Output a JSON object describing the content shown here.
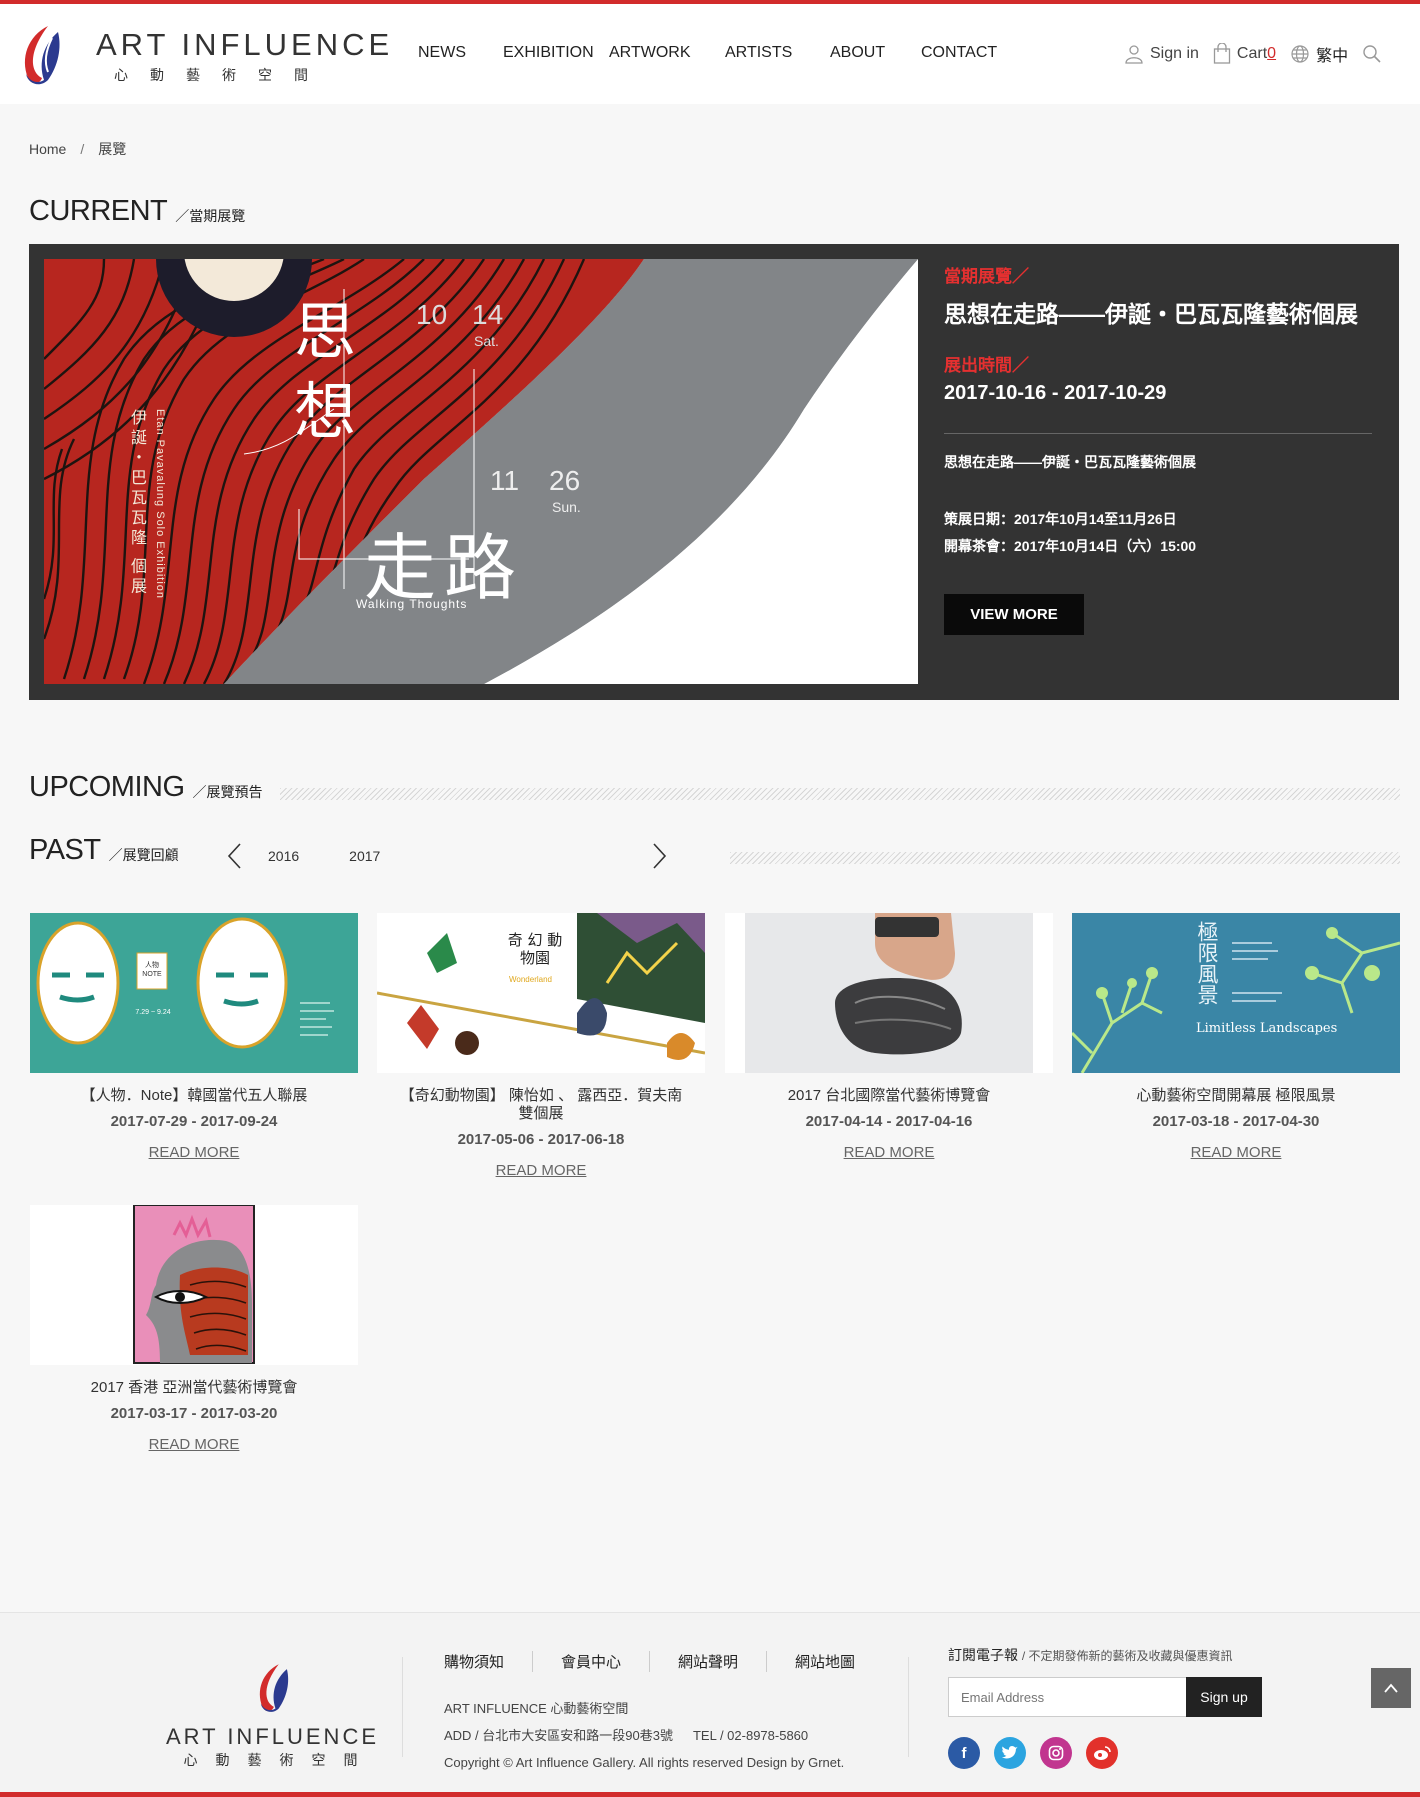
{
  "brand": {
    "en": "ART INFLUENCE",
    "zh": "心動藝術空間"
  },
  "nav": [
    "NEWS",
    "EXHIBITION",
    "ARTWORK",
    "ARTISTS",
    "ABOUT",
    "CONTACT"
  ],
  "header": {
    "signin": "Sign in",
    "cart": "Cart",
    "cart_count": "0",
    "lang": "繁中"
  },
  "breadcrumb": {
    "home": "Home",
    "sep": "/",
    "current": "展覽"
  },
  "sections": {
    "current_en": "CURRENT",
    "current_zh": "／當期展覽",
    "upcoming_en": "UPCOMING",
    "upcoming_zh": "／展覽預告",
    "past_en": "PAST",
    "past_zh": "／展覽回顧"
  },
  "current": {
    "label_current": "當期展覽／",
    "title": "思想在走路——伊誕‧巴瓦瓦隆藝術個展",
    "label_dates": "展出時間／",
    "dates": "2017-10-16 - 2017-10-29",
    "desc": "思想在走路——伊誕‧巴瓦瓦隆藝術個展",
    "curate": "策展日期：2017年10月14至11月26日",
    "opening": "開幕茶會：2017年10月14日（六）15:00",
    "button": "VIEW MORE",
    "poster": {
      "big1": "思",
      "big2": "想",
      "big3": "走",
      "big4": "路",
      "d1a": "10",
      "d1b": "14",
      "d1c": "Sat.",
      "d2a": "11",
      "d2b": "26",
      "d2c": "Sun.",
      "vert_zh": "伊誕・巴瓦瓦隆 個展",
      "vert_en": "Etan Pavavalung Solo Exhibition",
      "sub_en": "Walking Thoughts"
    }
  },
  "years": [
    "2016",
    "2017"
  ],
  "past": [
    {
      "title": "【人物．Note】韓國當代五人聯展",
      "dates": "2017-07-29 - 2017-09-24",
      "more": "READ MORE",
      "note_badge": "人物 NOTE",
      "note_dates": "7.29 ~ 9.24"
    },
    {
      "title": "【奇幻動物園】 陳怡如 、 露西亞．賀夫南雙個展",
      "dates": "2017-05-06 - 2017-06-18",
      "more": "READ MORE",
      "poster_zh": "奇 幻 動物園",
      "poster_en": "Wonderland"
    },
    {
      "title": "2017 台北國際當代藝術博覽會",
      "dates": "2017-04-14 - 2017-04-16",
      "more": "READ MORE"
    },
    {
      "title": "心動藝術空間開幕展 極限風景",
      "dates": "2017-03-18 - 2017-04-30",
      "more": "READ MORE",
      "poster_zh": "極限風景",
      "poster_en": "Limitless Landscapes"
    },
    {
      "title": "2017 香港 亞洲當代藝術博覽會",
      "dates": "2017-03-17 - 2017-03-20",
      "more": "READ MORE"
    }
  ],
  "footer": {
    "links": [
      "購物須知",
      "會員中心",
      "網站聲明",
      "網站地圖"
    ],
    "company": "ART INFLUENCE 心動藝術空間",
    "address": "ADD / 台北市大安區安和路一段90巷3號",
    "tel": "TEL / 02-8978-5860",
    "copyright": "Copyright © Art Influence Gallery. All rights reserved Design by Grnet.",
    "subscribe_title": "訂閱電子報",
    "subscribe_note": "/ 不定期發佈新的藝術及收藏與優惠資訊",
    "email_placeholder": "Email Address",
    "signup": "Sign up",
    "social": [
      "f",
      "t",
      "ig",
      "wb"
    ]
  },
  "colors": {
    "accent": "#d22b2b",
    "dark_panel": "#333333",
    "facebook": "#2b5aa5",
    "twitter": "#2ba4e0",
    "instagram": "#c1358f",
    "weibo": "#e2312b"
  }
}
